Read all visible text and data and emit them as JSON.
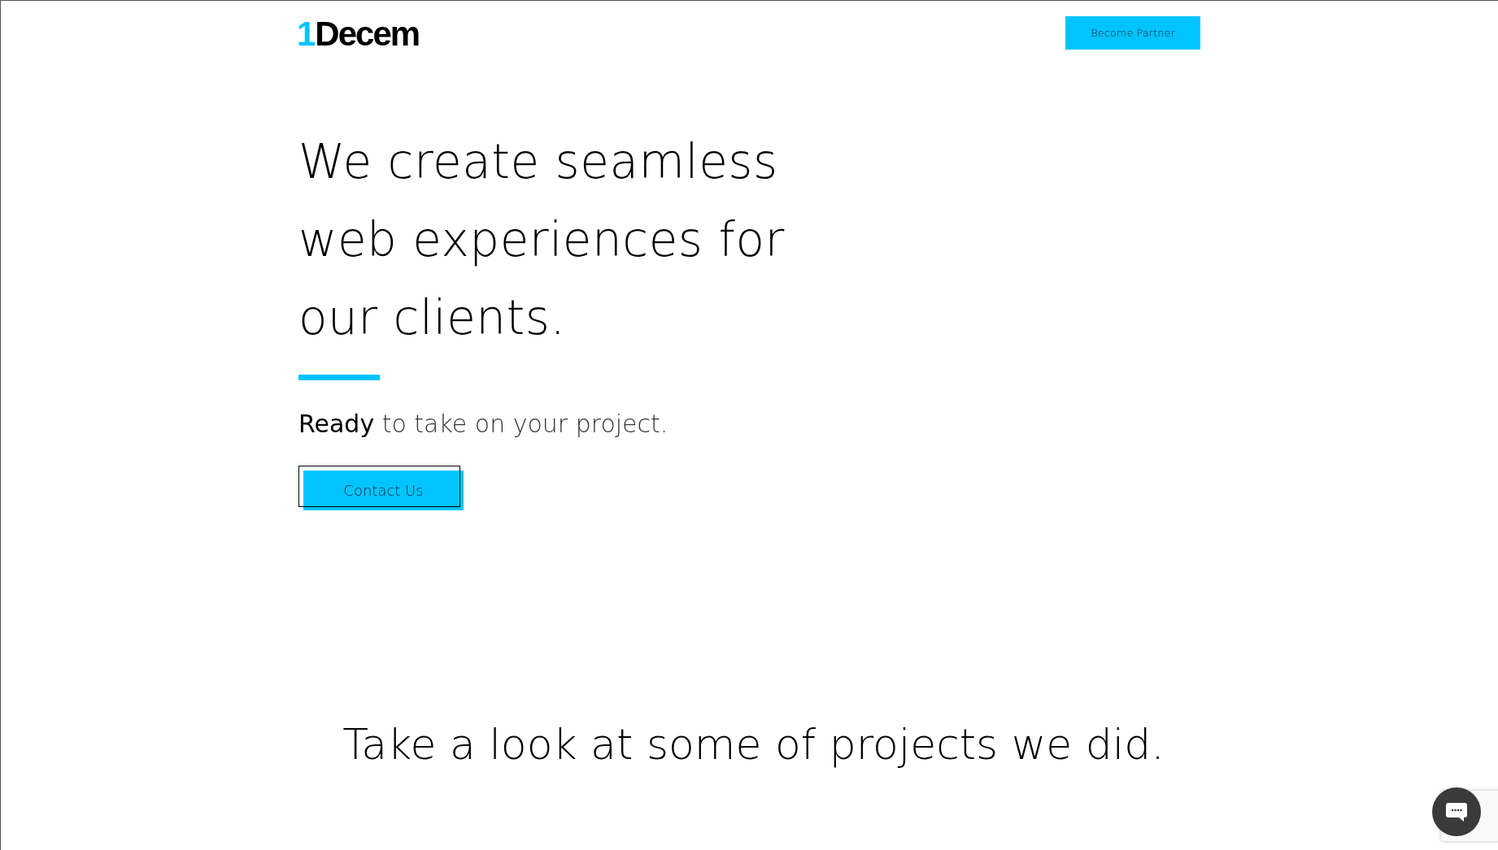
{
  "header": {
    "logo": {
      "mark": "1",
      "text": "Decem"
    },
    "cta": "Become Partner"
  },
  "hero": {
    "headline_lines": [
      "We create seamless",
      "web experiences for",
      "our clients."
    ],
    "tagline": "**Ready** to take on your project.",
    "button": "Contact Us"
  },
  "projects": {
    "heading": "Take a look at some of projects we did."
  }
}
